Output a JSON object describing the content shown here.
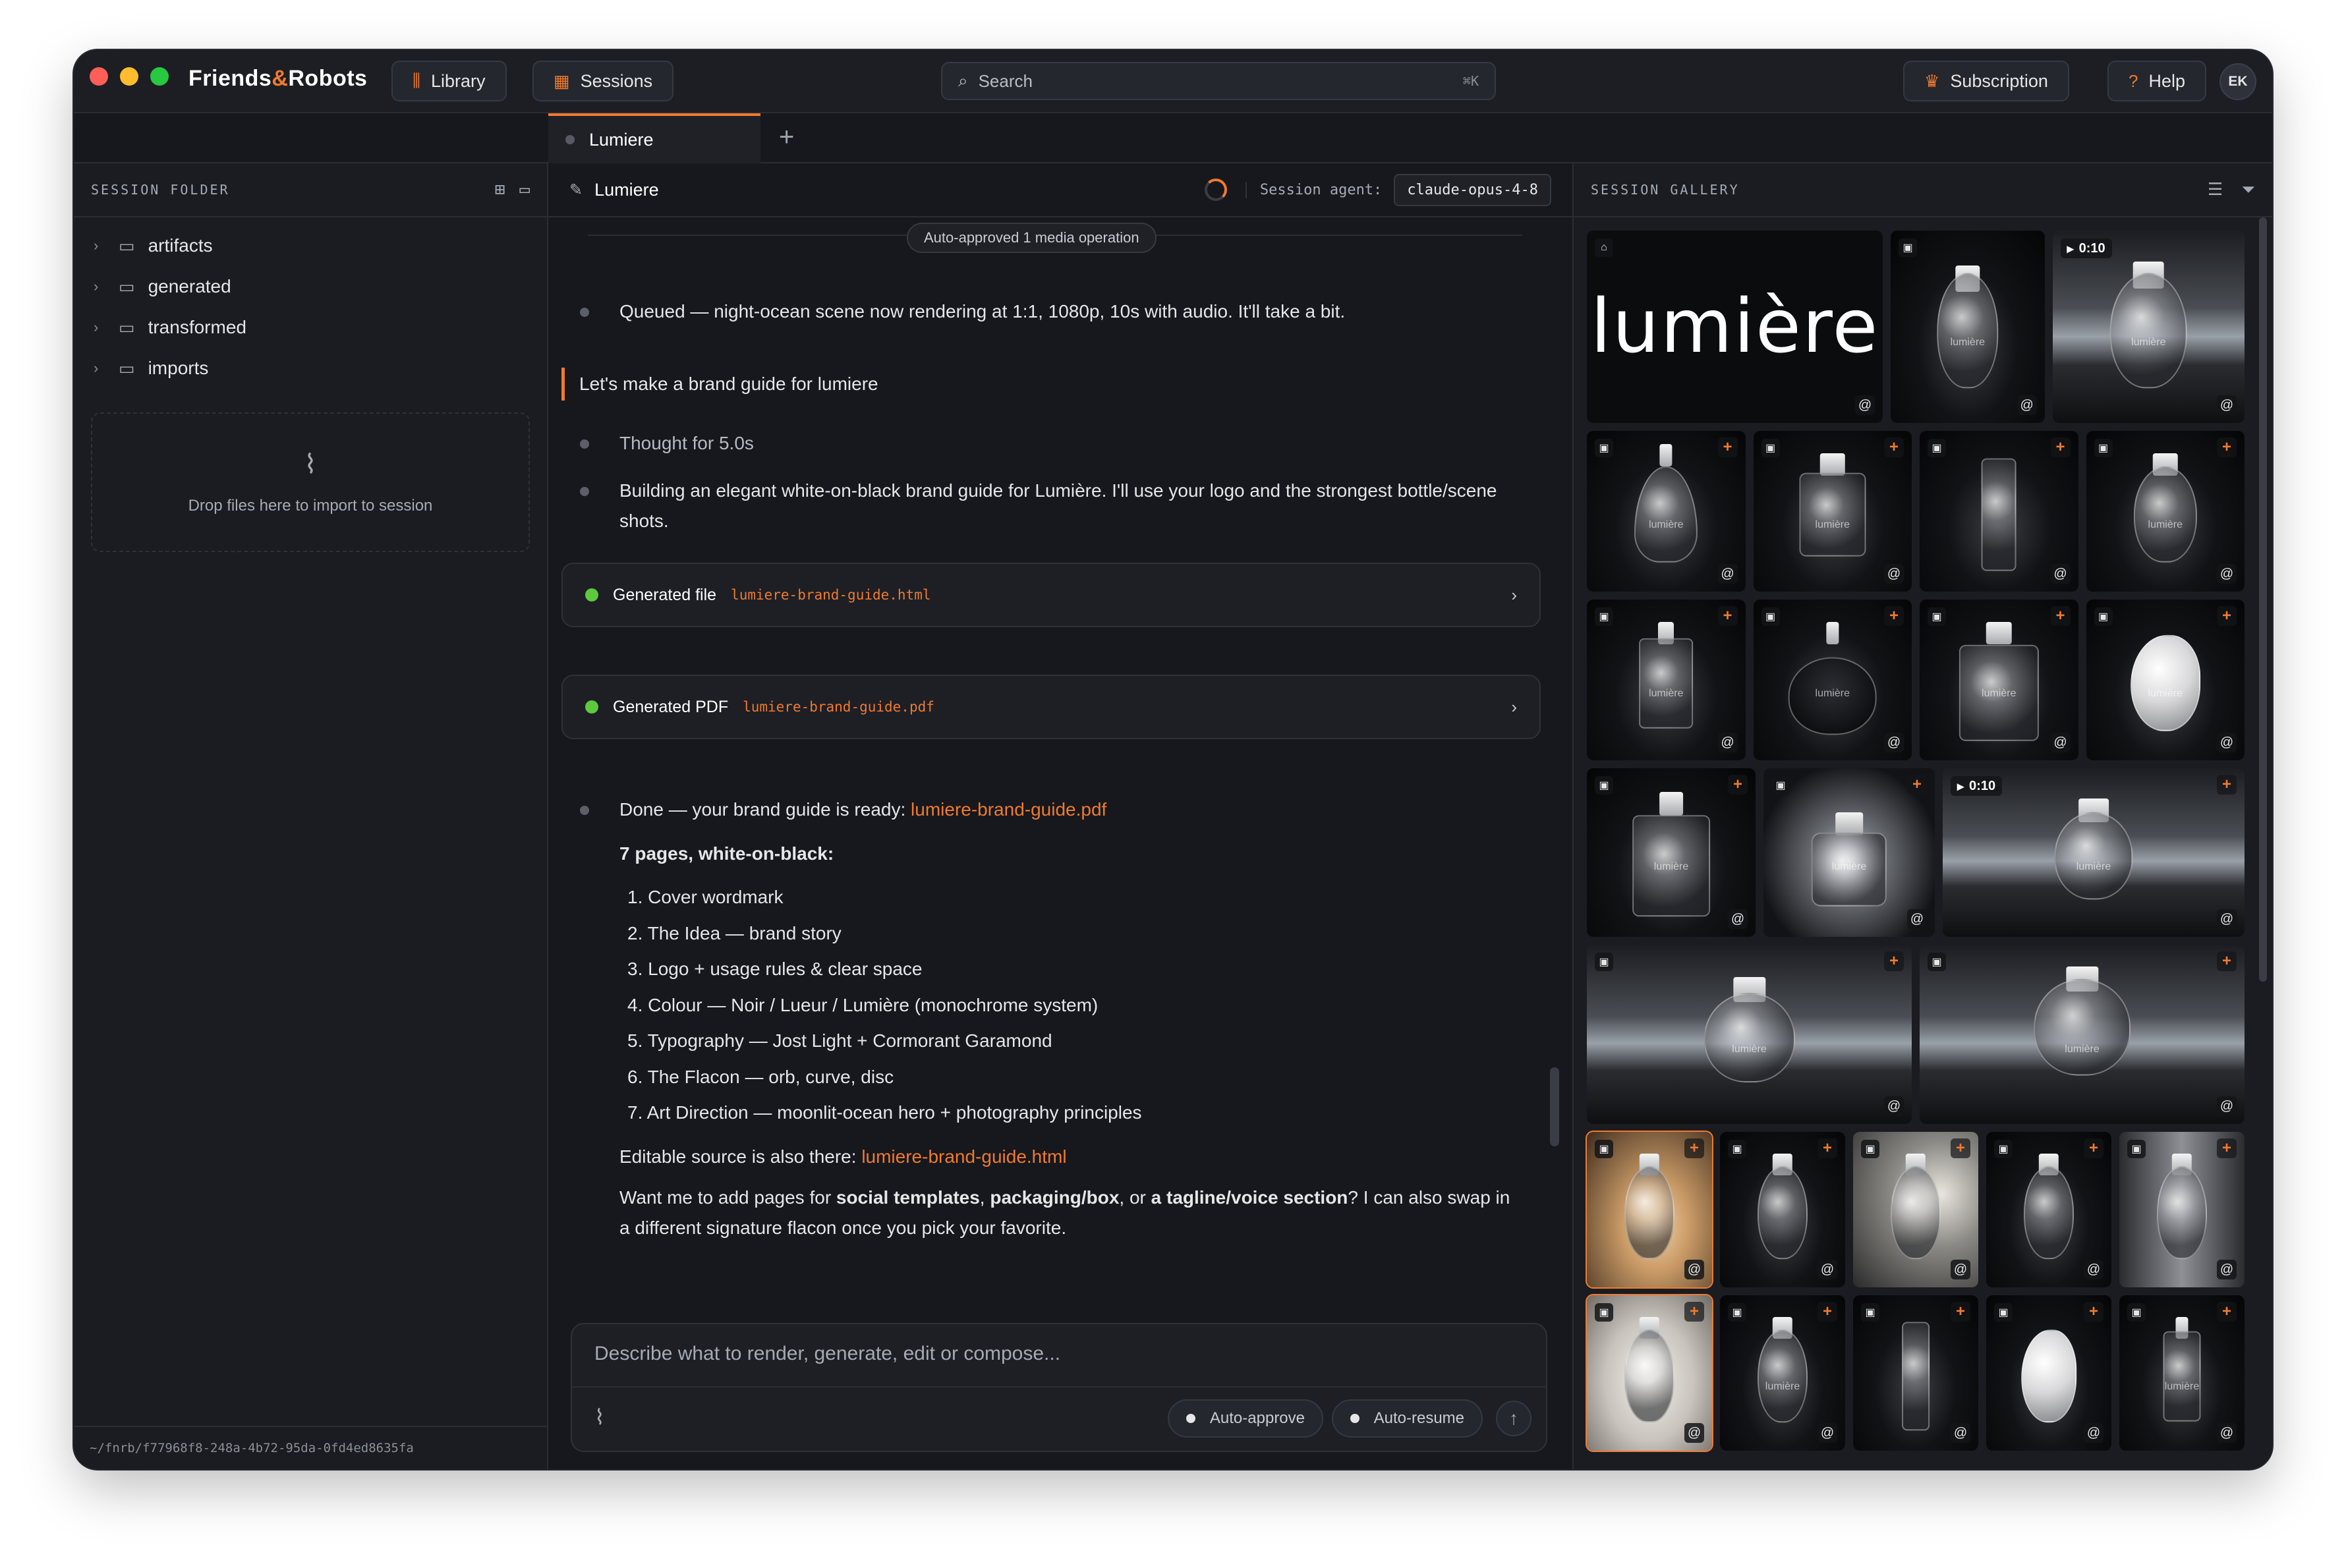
{
  "app": {
    "brand_part1": "Friends",
    "brand_amp": "&",
    "brand_part2": "Robots",
    "nav": {
      "library": "Library",
      "sessions": "Sessions"
    },
    "search": {
      "placeholder": "Search",
      "shortcut": "⌘K"
    },
    "subscription": "Subscription",
    "help": "Help",
    "user_initials": "EK"
  },
  "tabs": [
    {
      "label": "Lumiere"
    }
  ],
  "tab_add": "+",
  "session_folder": {
    "title": "SESSION FOLDER",
    "items": [
      {
        "label": "artifacts"
      },
      {
        "label": "generated"
      },
      {
        "label": "transformed"
      },
      {
        "label": "imports"
      }
    ],
    "dropzone_text": "Drop files here to import to session",
    "path": "~/fnrb/f77968f8-248a-4b72-95da-0fd4ed8635fa"
  },
  "session": {
    "title": "Lumiere",
    "agent_label": "Session agent:",
    "agent_value": "claude-opus-4-8"
  },
  "chat": {
    "banner": "Auto-approved 1 media operation",
    "queued": "Queued — night-ocean scene now rendering at 1:1, 1080p, 10s with audio. It'll take a bit.",
    "user_message": "Let's make a brand guide for lumiere",
    "thought": "Thought for 5.0s",
    "building": "Building an elegant white-on-black brand guide for Lumière. I'll use your logo and the strongest bottle/scene shots.",
    "file1": {
      "label": "Generated file",
      "name": "lumiere-brand-guide.html"
    },
    "file2": {
      "label": "Generated PDF",
      "name": "lumiere-brand-guide.pdf"
    },
    "done_prefix": "Done — your brand guide is ready: ",
    "done_link": "lumiere-brand-guide.pdf",
    "pages_heading": "7 pages, white-on-black:",
    "pages": [
      "1. Cover wordmark",
      "2. The Idea — brand story",
      "3. Logo + usage rules & clear space",
      "4. Colour — Noir / Lueur / Lumière (monochrome system)",
      "5. Typography — Jost Light + Cormorant Garamond",
      "6. The Flacon — orb, curve, disc",
      "7. Art Direction — moonlit-ocean hero + photography principles"
    ],
    "source_prefix": "Editable source is also there: ",
    "source_link": "lumiere-brand-guide.html",
    "offer_1": "Want me to add pages for ",
    "offer_b1": "social templates",
    "offer_2": ", ",
    "offer_b2": "packaging/box",
    "offer_3": ", or ",
    "offer_b3": "a tagline/voice section",
    "offer_4": "? I can also swap in a different signature flacon once you pick your favorite."
  },
  "composer": {
    "placeholder": "Describe what to render, generate, edit or compose...",
    "auto_approve": "Auto-approve",
    "auto_resume": "Auto-resume"
  },
  "gallery": {
    "title": "SESSION GALLERY",
    "logo_text": "lumière",
    "bottle_label": "lumière",
    "video_duration": "0:10"
  },
  "colors": {
    "accent": "#f07a2e",
    "success": "#5ec93c",
    "background": "#16181d"
  }
}
